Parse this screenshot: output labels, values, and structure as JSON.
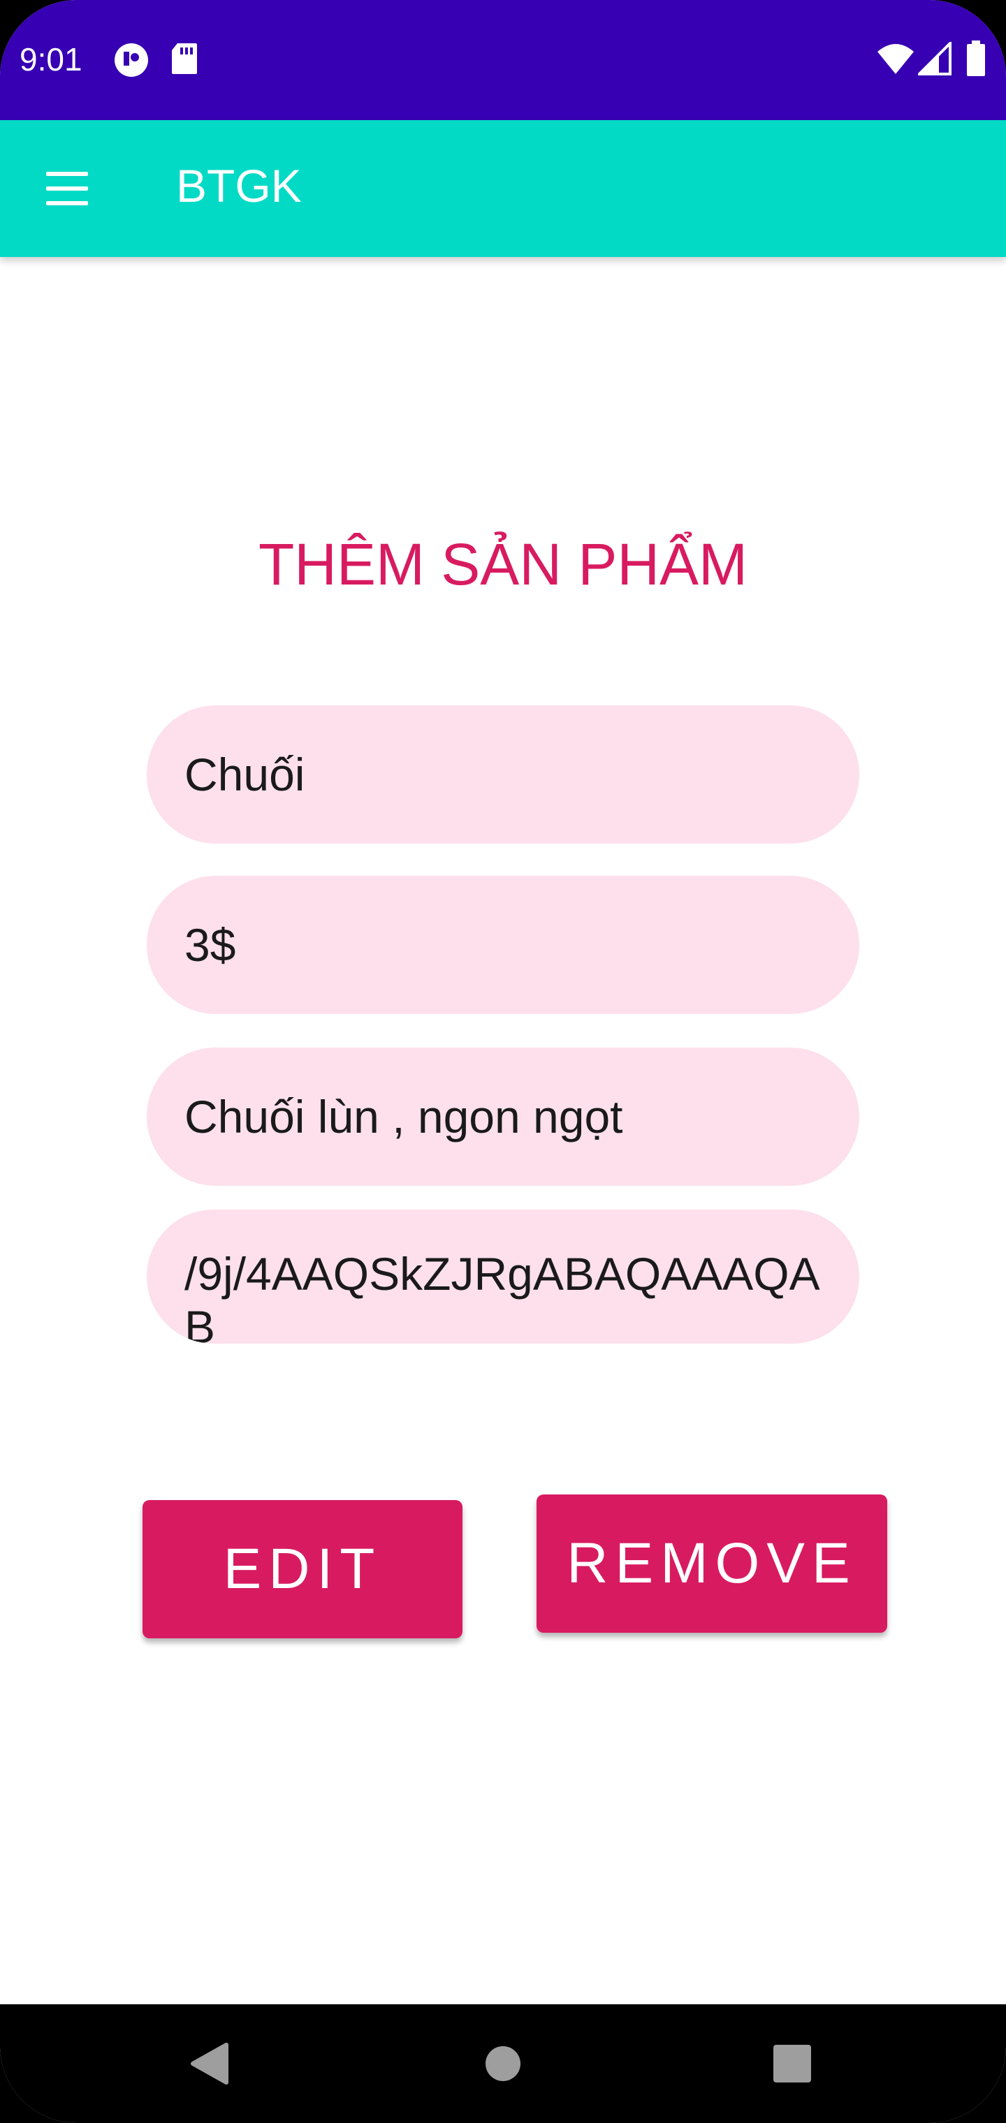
{
  "status_bar": {
    "time": "9:01",
    "background_color": "#3700b3",
    "left_icons": [
      "media-notification-icon",
      "sd-card-icon"
    ],
    "right_icons": [
      "wifi-icon",
      "cellular-signal-icon",
      "battery-icon"
    ]
  },
  "app_bar": {
    "title": "BTGK",
    "background_color": "#03dac5",
    "menu_icon": "hamburger-menu-icon"
  },
  "main": {
    "heading": "THÊM SẢN PHẨM",
    "heading_color": "#d81b60",
    "fields": {
      "name_value": "Chuối",
      "price_value": "3$",
      "description_value": "Chuối lùn , ngon ngọt",
      "image_value": "/9j/4AAQSkZJRgABAQAAAQAB"
    },
    "field_background_color": "#fde0ec",
    "buttons": {
      "edit_label": "EDIT",
      "remove_label": "REMOVE",
      "color": "#d81b60"
    }
  },
  "nav_bar": {
    "icons": [
      "back-icon",
      "home-icon",
      "recents-icon"
    ]
  }
}
